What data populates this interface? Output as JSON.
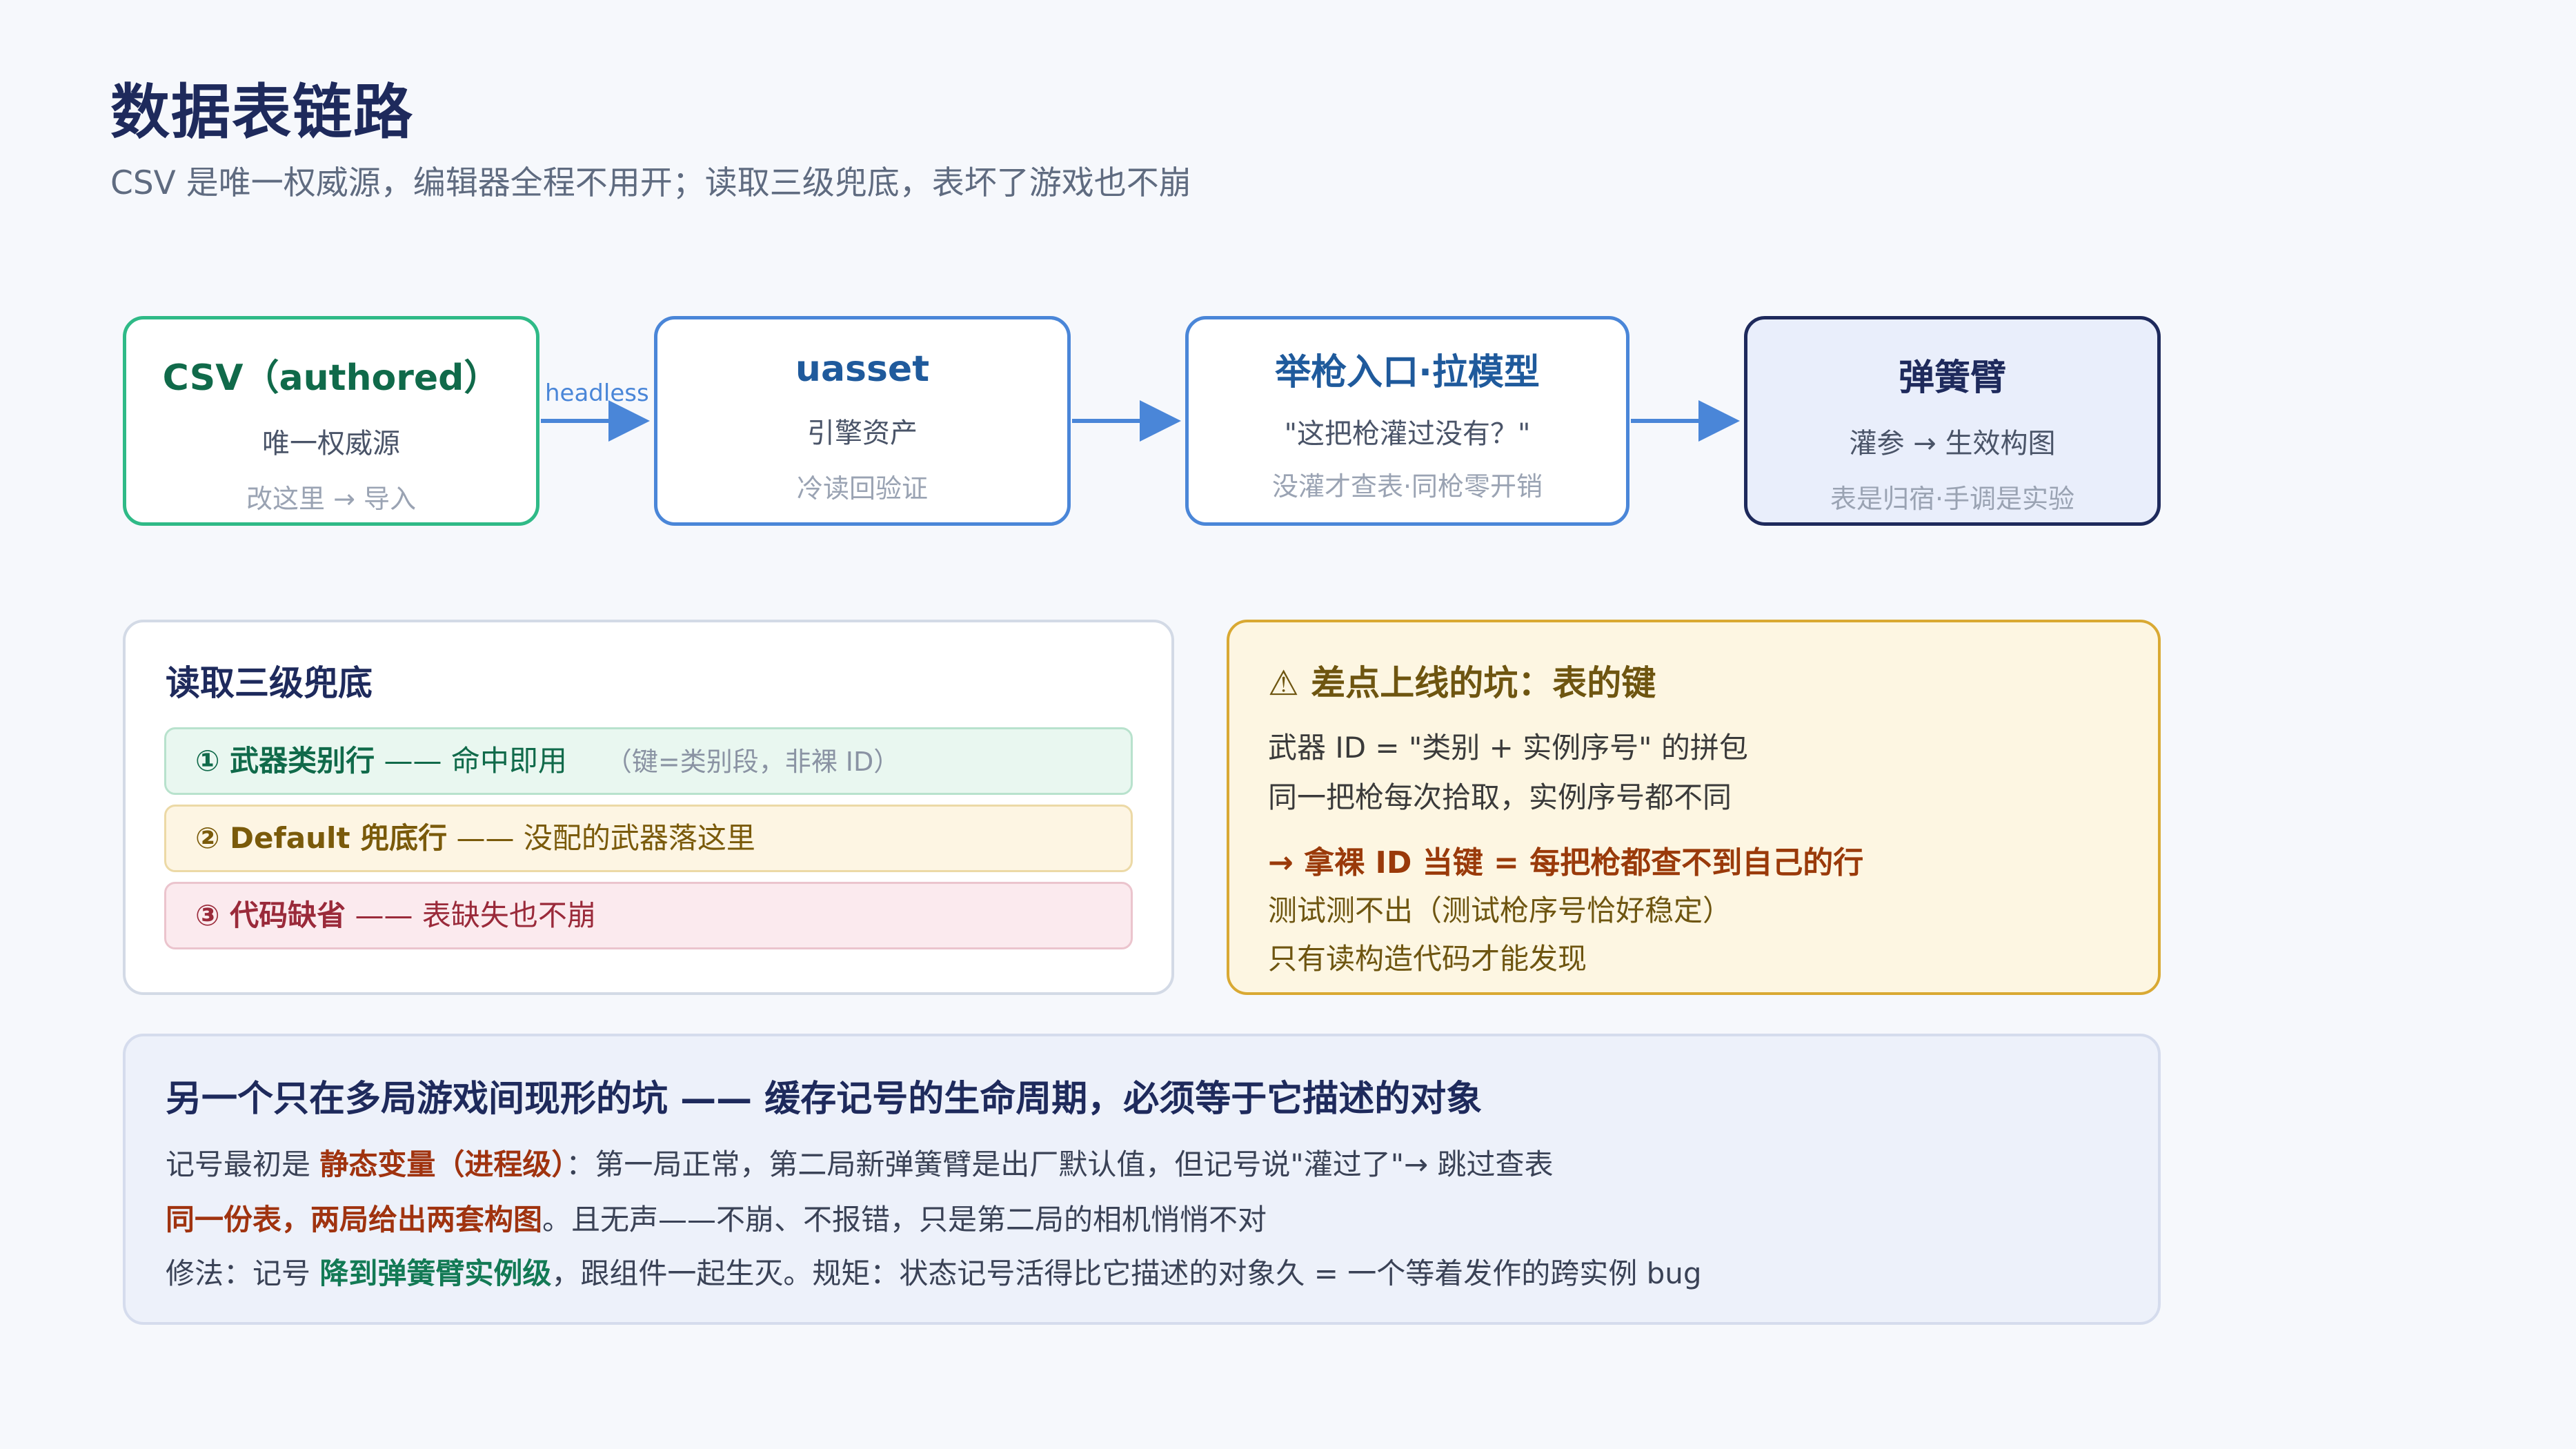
{
  "header": {
    "title": "数据表链路",
    "subtitle": "CSV 是唯一权威源，编辑器全程不用开；读取三级兜底，表坏了游戏也不崩"
  },
  "pipeline": {
    "nodes": [
      {
        "title": "CSV（authored）",
        "line1": "唯一权威源",
        "line2": "改这里 → 导入"
      },
      {
        "title": "uasset",
        "line1": "引擎资产",
        "line2": "冷读回验证"
      },
      {
        "title": "举枪入口·拉模型",
        "line1": "\"这把枪灌过没有？\"",
        "line2": "没灌才查表·同枪零开销"
      },
      {
        "title": "弹簧臂",
        "line1": "灌参 → 生效构图",
        "line2": "表是归宿·手调是实验"
      }
    ],
    "edge_label": "headless"
  },
  "fallback": {
    "title": "读取三级兜底",
    "rows": [
      {
        "key": "① 武器类别行",
        "desc": " —— 命中即用",
        "note": "（键=类别段，非裸 ID）"
      },
      {
        "key": "② Default 兜底行",
        "desc": " —— 没配的武器落这里",
        "note": ""
      },
      {
        "key": "③ 代码缺省",
        "desc": " —— 表缺失也不崩",
        "note": ""
      }
    ]
  },
  "pitfall": {
    "icon": "warning-icon",
    "title": "差点上线的坑：表的键",
    "line1": "武器 ID = \"类别 + 实例序号\" 的拼包",
    "line2": "同一把枪每次拾取，实例序号都不同",
    "line3": "→ 拿裸 ID 当键 = 每把枪都查不到自己的行",
    "line4": "测试测不出（测试枪序号恰好稳定）",
    "line5": "只有读构造代码才能发现"
  },
  "lifecycle": {
    "title": "另一个只在多局游戏间现形的坑 —— 缓存记号的生命周期，必须等于它描述的对象",
    "l1_pre": "记号最初是 ",
    "l1_hl": "静态变量（进程级）",
    "l1_post": "：第一局正常，第二局新弹簧臂是出厂默认值，但记号说\"灌过了\"→ 跳过查表",
    "l2_hl": "同一份表，两局给出两套构图",
    "l2_post": "。且无声——不崩、不报错，只是第二局的相机悄悄不对",
    "l3_pre": "修法：记号 ",
    "l3_hl": "降到弹簧臂实例级",
    "l3_post": "，跟组件一起生灭。规矩：状态记号活得比它描述的对象久 = 一个等着发作的跨实例 bug"
  }
}
